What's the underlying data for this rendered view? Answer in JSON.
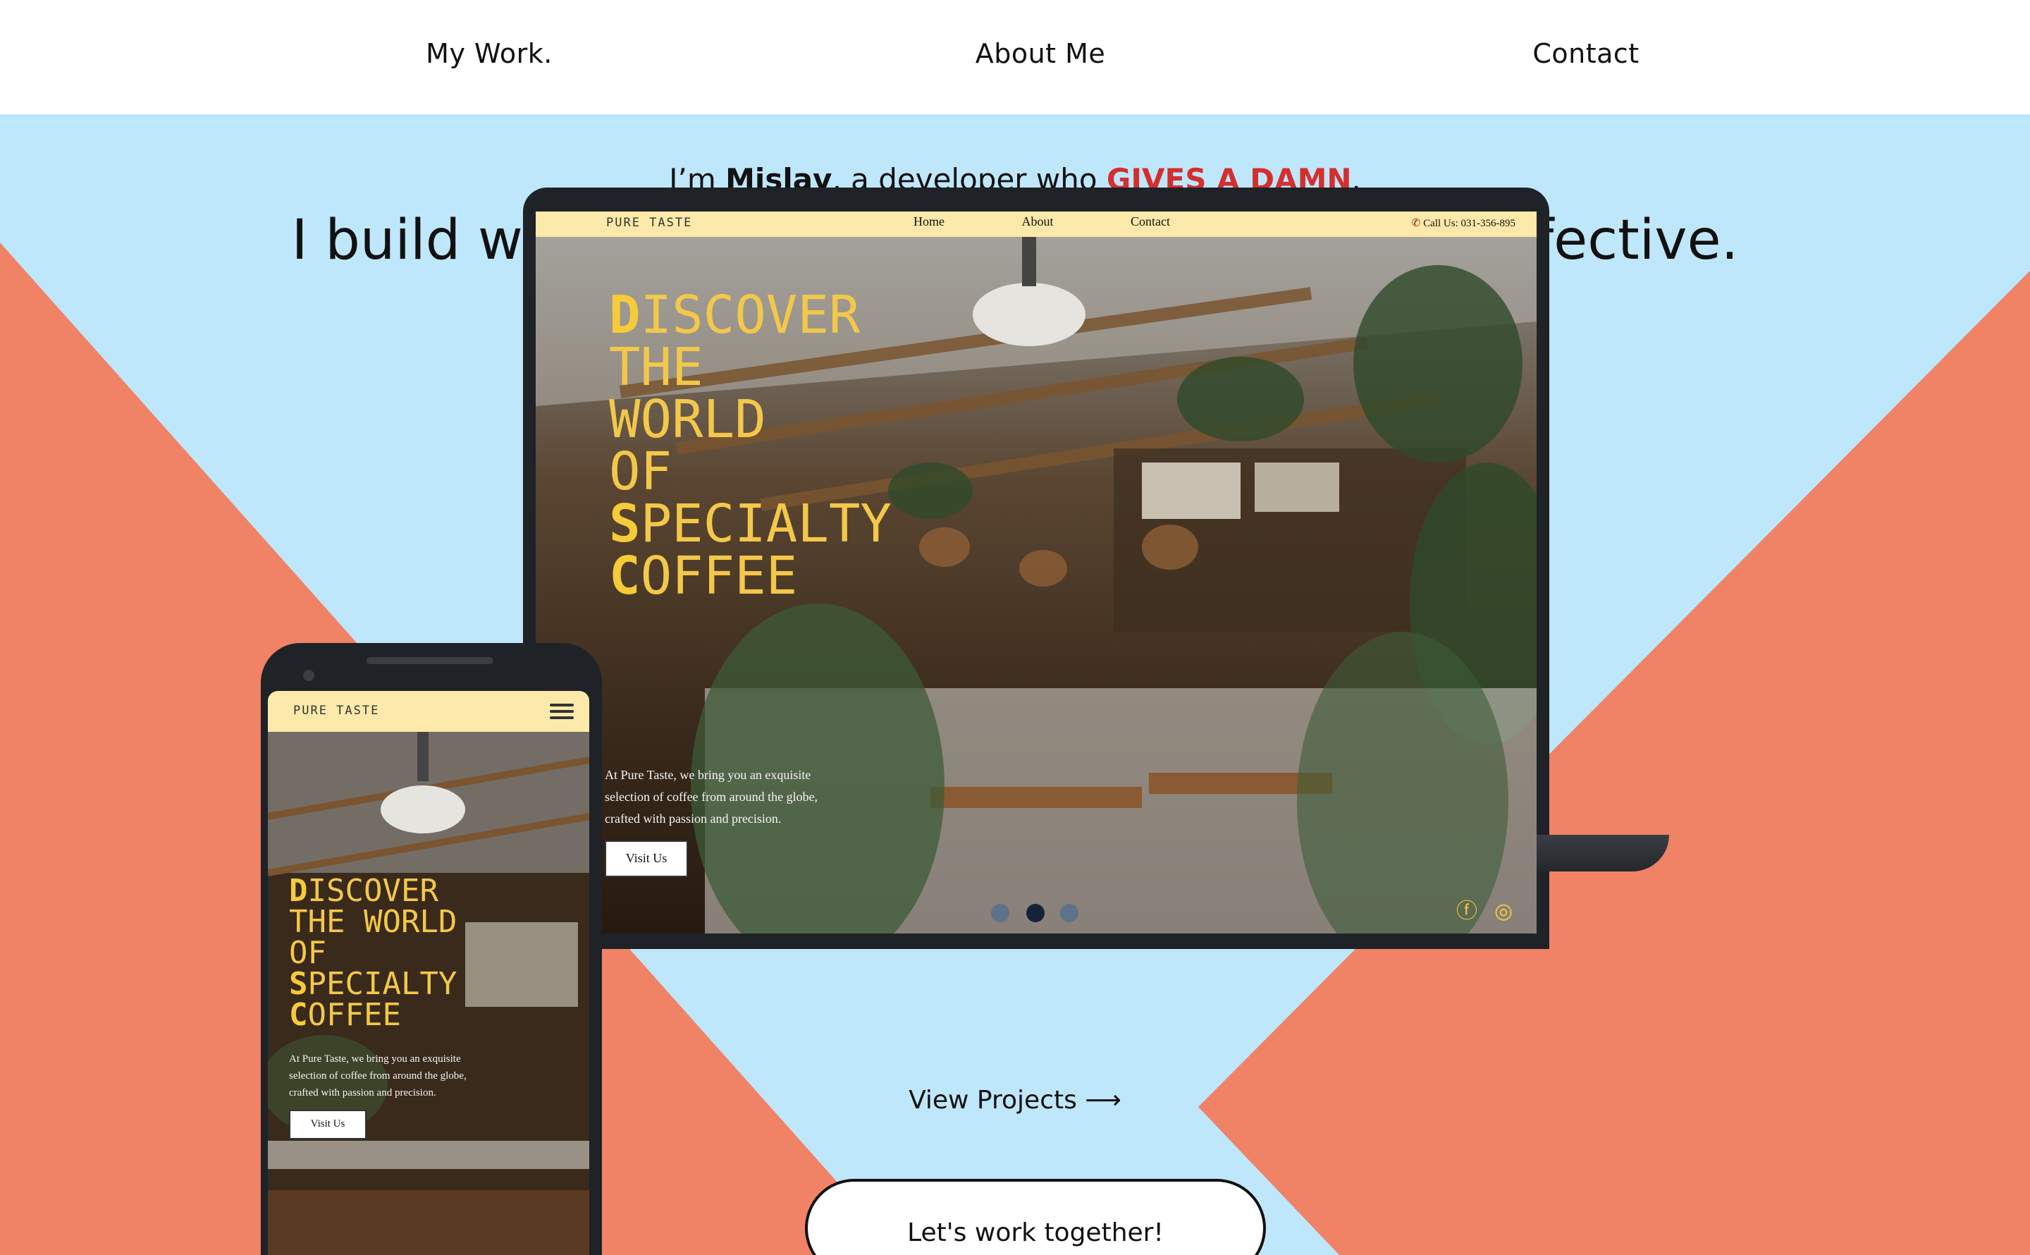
{
  "nav": {
    "items": [
      {
        "label": "My Work."
      },
      {
        "label": "About Me"
      },
      {
        "label": "Contact"
      }
    ]
  },
  "hero": {
    "tagline_prefix": "I’m ",
    "tagline_name": "Mislav",
    "tagline_middle": ", a developer who ",
    "tagline_emphasis": "GIVES A DAMN",
    "tagline_suffix": ".",
    "headline": "I build websites that are fast, focused, and effective."
  },
  "project_preview": {
    "site_logo": "PURE TASTE",
    "site_nav": [
      "Home",
      "About",
      "Contact"
    ],
    "site_phone": "Call Us: 031-356-895",
    "hero_lines": [
      {
        "cap": "D",
        "rest": "ISCOVER"
      },
      {
        "cap": "",
        "rest": "THE"
      },
      {
        "cap": "",
        "rest": "WORLD"
      },
      {
        "cap": "",
        "rest": "OF"
      },
      {
        "cap": "S",
        "rest": "PECIALTY"
      },
      {
        "cap": "C",
        "rest": "OFFEE"
      }
    ],
    "mobile_hero_lines": [
      {
        "cap": "D",
        "rest": "ISCOVER"
      },
      {
        "cap": "",
        "rest": "THE WORLD"
      },
      {
        "cap": "",
        "rest": "OF"
      },
      {
        "cap": "S",
        "rest": "PECIALTY"
      },
      {
        "cap": "C",
        "rest": "OFFEE"
      }
    ],
    "body_lines": [
      "At Pure Taste, we bring you an exquisite",
      "selection of coffee from around the globe,",
      "crafted with passion and precision."
    ],
    "visit_label": "Visit Us",
    "social_icons": [
      "facebook-icon",
      "instagram-icon"
    ]
  },
  "carousel": {
    "count": 3,
    "active_index": 1
  },
  "actions": {
    "view_projects": "View Projects ⟶",
    "cta": "Let's work together!"
  },
  "colors": {
    "hero_bg": "#bfe7fb",
    "accent_shapes": "#f08266",
    "emphasis": "#d32f2f",
    "site_bar": "#fde9a9",
    "headline_gold": "#f3c84a"
  }
}
